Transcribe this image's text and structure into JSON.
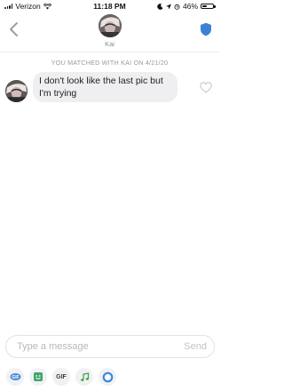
{
  "status_bar": {
    "carrier": "Verizon",
    "time": "11:18 PM",
    "battery": "46%",
    "battery_level": 0.46
  },
  "header": {
    "name": "Kai"
  },
  "conversation": {
    "match_text": "YOU MATCHED WITH KAI ON 4/21/20",
    "messages": [
      {
        "text": "I don't look like the last pic but I'm trying"
      }
    ]
  },
  "composer": {
    "placeholder": "Type a message",
    "send_label": "Send"
  },
  "toolbar": {
    "gif_label": "GIF",
    "icons": [
      "sticker-icon",
      "bitmoji-icon",
      "gif-icon",
      "music-icon",
      "loop-icon"
    ]
  },
  "colors": {
    "accent_blue": "#3b82d6",
    "bubble_bg": "#efeff1",
    "music_green": "#39a94b",
    "gif_dark": "#3b3b3b"
  }
}
